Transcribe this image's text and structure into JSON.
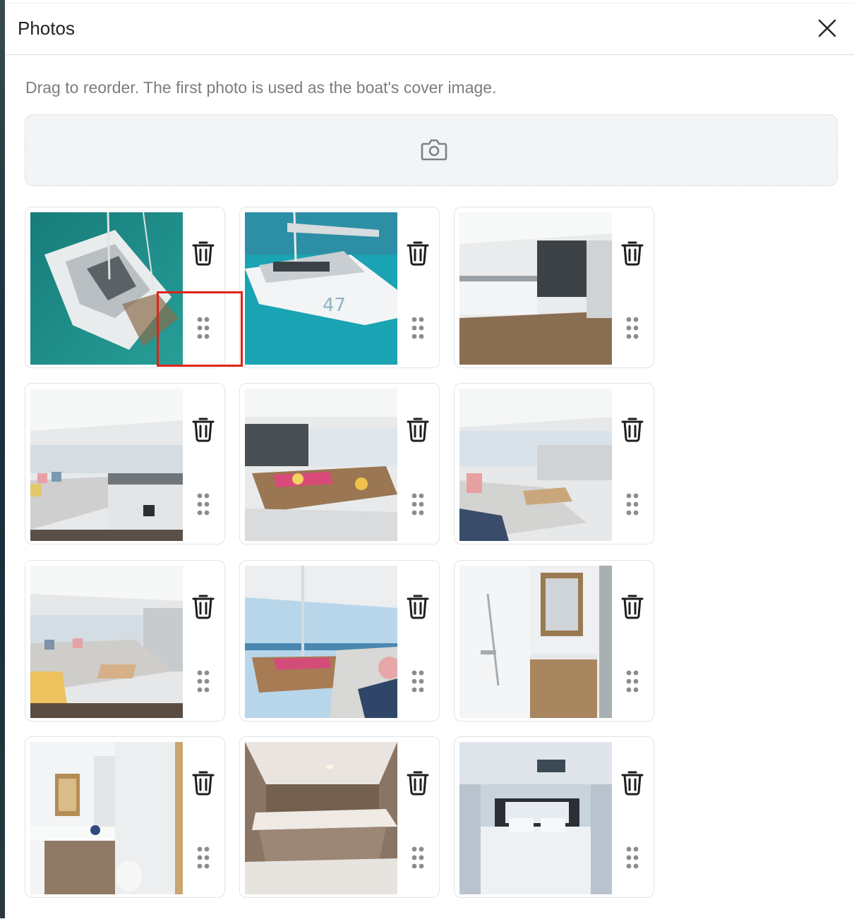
{
  "modal": {
    "title": "Photos",
    "close_icon": "close-icon",
    "hint": "Drag to reorder. The first photo is used as the boat's cover image.",
    "upload_icon": "camera-icon"
  },
  "photos": [
    {
      "subject": "catamaran-aerial",
      "delete_icon": "trash-icon",
      "drag_icon": "drag-handle-icon"
    },
    {
      "subject": "catamaran-side",
      "delete_icon": "trash-icon",
      "drag_icon": "drag-handle-icon"
    },
    {
      "subject": "galley-interior",
      "delete_icon": "trash-icon",
      "drag_icon": "drag-handle-icon"
    },
    {
      "subject": "saloon-sofa",
      "delete_icon": "trash-icon",
      "drag_icon": "drag-handle-icon"
    },
    {
      "subject": "saloon-dining",
      "delete_icon": "trash-icon",
      "drag_icon": "drag-handle-icon"
    },
    {
      "subject": "saloon-wide",
      "delete_icon": "trash-icon",
      "drag_icon": "drag-handle-icon"
    },
    {
      "subject": "saloon-lounge",
      "delete_icon": "trash-icon",
      "drag_icon": "drag-handle-icon"
    },
    {
      "subject": "cockpit-dining",
      "delete_icon": "trash-icon",
      "drag_icon": "drag-handle-icon"
    },
    {
      "subject": "shower",
      "delete_icon": "trash-icon",
      "drag_icon": "drag-handle-icon"
    },
    {
      "subject": "bathroom",
      "delete_icon": "trash-icon",
      "drag_icon": "drag-handle-icon"
    },
    {
      "subject": "bunk-cabin",
      "delete_icon": "trash-icon",
      "drag_icon": "drag-handle-icon"
    },
    {
      "subject": "double-cabin",
      "delete_icon": "trash-icon",
      "drag_icon": "drag-handle-icon"
    }
  ],
  "colors": {
    "highlight": "#e0231b",
    "icon": "#1e1e1e",
    "drag_dots": "#8a8d90"
  }
}
